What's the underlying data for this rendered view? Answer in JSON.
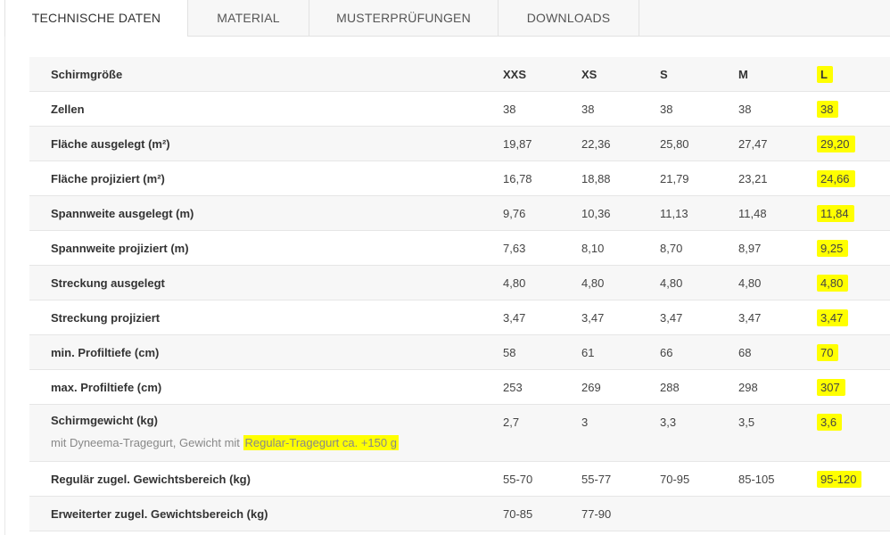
{
  "tabs": [
    {
      "label": "TECHNISCHE DATEN",
      "active": true
    },
    {
      "label": "MATERIAL",
      "active": false
    },
    {
      "label": "MUSTERPRÜFUNGEN",
      "active": false
    },
    {
      "label": "DOWNLOADS",
      "active": false
    }
  ],
  "table": {
    "headers": [
      "Schirmgröße",
      "XXS",
      "XS",
      "S",
      "M",
      "L"
    ],
    "rows": [
      {
        "label": "Zellen",
        "values": [
          "38",
          "38",
          "38",
          "38",
          "38"
        ]
      },
      {
        "label": "Fläche ausgelegt (m²)",
        "values": [
          "19,87",
          "22,36",
          "25,80",
          "27,47",
          "29,20"
        ]
      },
      {
        "label": "Fläche projiziert (m²)",
        "values": [
          "16,78",
          "18,88",
          "21,79",
          "23,21",
          "24,66"
        ]
      },
      {
        "label": "Spannweite ausgelegt (m)",
        "values": [
          "9,76",
          "10,36",
          "11,13",
          "11,48",
          "11,84"
        ]
      },
      {
        "label": "Spannweite projiziert (m)",
        "values": [
          "7,63",
          "8,10",
          "8,70",
          "8,97",
          "9,25"
        ]
      },
      {
        "label": "Streckung ausgelegt",
        "values": [
          "4,80",
          "4,80",
          "4,80",
          "4,80",
          "4,80"
        ]
      },
      {
        "label": "Streckung projiziert",
        "values": [
          "3,47",
          "3,47",
          "3,47",
          "3,47",
          "3,47"
        ]
      },
      {
        "label": "min. Profiltiefe (cm)",
        "values": [
          "58",
          "61",
          "66",
          "68",
          "70"
        ]
      },
      {
        "label": "max. Profiltiefe (cm)",
        "values": [
          "253",
          "269",
          "288",
          "298",
          "307"
        ]
      },
      {
        "label": "Schirmgewicht (kg)",
        "note_prefix": "mit Dyneema-Tragegurt, Gewicht mit ",
        "note_highlight": "Regular-Tragegurt ca. +150 g",
        "values": [
          "2,7",
          "3",
          "3,3",
          "3,5",
          "3,6"
        ]
      },
      {
        "label": "Regulär zugel. Gewichtsbereich (kg)",
        "values": [
          "55-70",
          "55-77",
          "70-95",
          "85-105",
          "95-120"
        ]
      },
      {
        "label": "Erweiterter zugel. Gewichtsbereich (kg)",
        "values": [
          "70-85",
          "77-90",
          "",
          "",
          ""
        ]
      }
    ]
  },
  "colors": {
    "highlight": "#ffff00",
    "stripe": "#f7f7f7"
  }
}
